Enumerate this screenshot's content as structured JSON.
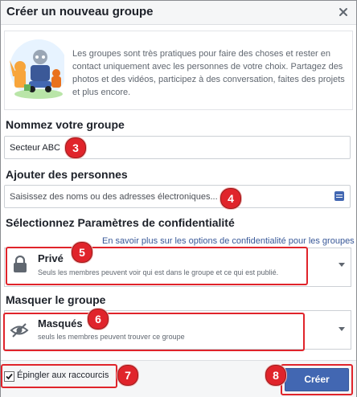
{
  "dialog": {
    "title": "Créer un nouveau groupe",
    "close_icon": "close-icon"
  },
  "banner": {
    "text": "Les groupes sont très pratiques pour faire des choses et rester en contact uniquement avec les personnes de votre choix. Partagez des photos et des vidéos, participez à des conversation, faites des projets et plus encore."
  },
  "name_section": {
    "label": "Nommez votre groupe",
    "value": "Secteur ABC",
    "badge": "3"
  },
  "people_section": {
    "label": "Ajouter des personnes",
    "placeholder": "Saisissez des noms ou des adresses électroniques...",
    "badge": "4",
    "icon": "compose-icon"
  },
  "privacy_section": {
    "label": "Sélectionnez Paramètres de confidentialité",
    "link": "En savoir plus sur les options de confidentialité pour les groupes",
    "option_title": "Privé",
    "option_desc": "Seuls les membres peuvent voir qui est dans le groupe et ce qui est publié.",
    "badge": "5",
    "icon": "lock-icon"
  },
  "hide_section": {
    "label": "Masquer le groupe",
    "option_title": "Masqués",
    "option_desc": "seuls les membres peuvent trouver ce groupe",
    "badge": "6",
    "icon": "hidden-eye-icon"
  },
  "footer": {
    "pin_label": "Épingler aux raccourcis",
    "pin_checked": true,
    "pin_badge": "7",
    "create_label": "Créer",
    "create_badge": "8"
  },
  "colors": {
    "accent": "#4267b2",
    "annotation": "#e0242b"
  }
}
